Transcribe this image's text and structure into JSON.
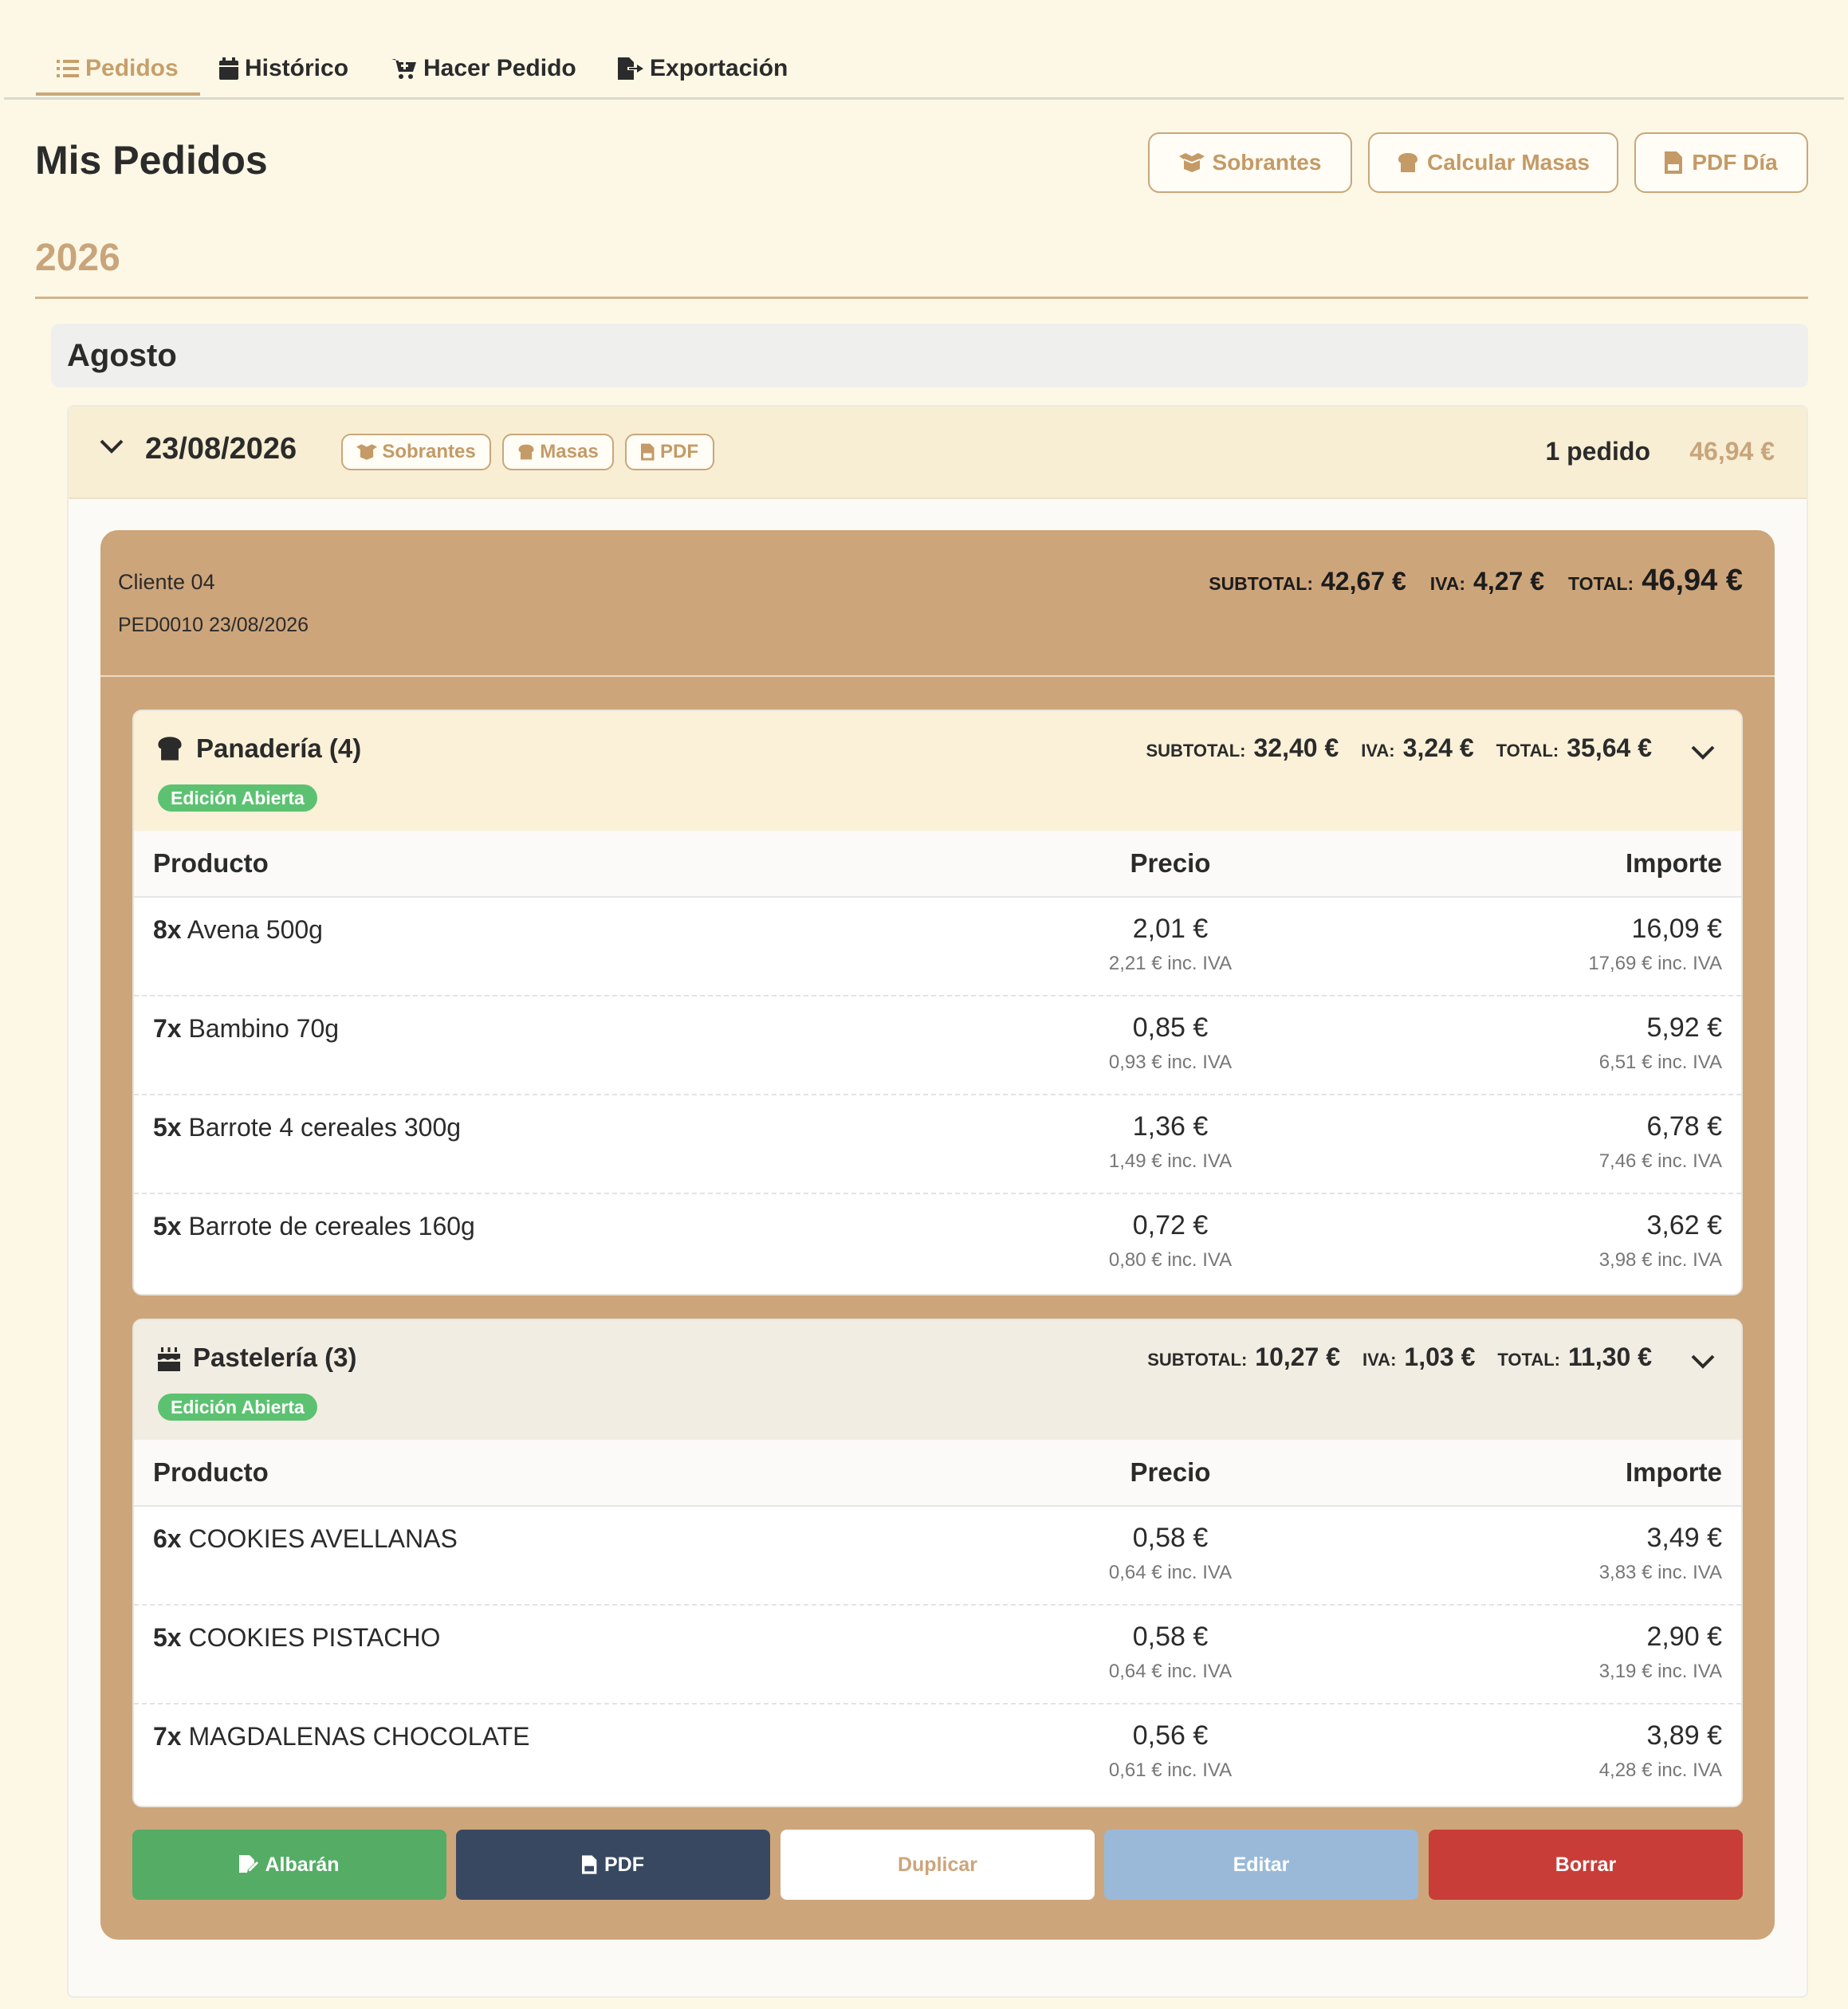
{
  "nav": {
    "tabs": [
      {
        "label": "Pedidos",
        "icon": "list-icon",
        "active": true
      },
      {
        "label": "Histórico",
        "icon": "calendar-icon",
        "active": false
      },
      {
        "label": "Hacer Pedido",
        "icon": "cart-icon",
        "active": false
      },
      {
        "label": "Exportación",
        "icon": "file-export-icon",
        "active": false
      }
    ]
  },
  "header": {
    "title": "Mis Pedidos",
    "buttons": {
      "leftovers": "Sobrantes",
      "calc_doughs": "Calcular Masas",
      "pdf_day": "PDF Día"
    }
  },
  "year": "2026",
  "month": "Agosto",
  "day": {
    "date": "23/08/2026",
    "buttons": {
      "leftovers": "Sobrantes",
      "doughs": "Masas",
      "pdf": "PDF"
    },
    "order_count": "1 pedido",
    "total": "46,94 €"
  },
  "order": {
    "client": "Cliente 04",
    "reference": "PED0010 23/08/2026",
    "labels": {
      "subtotal": "SUBTOTAL:",
      "iva": "IVA:",
      "total": "TOTAL:"
    },
    "subtotal": "42,67 €",
    "iva": "4,27 €",
    "total": "46,94 €",
    "table_headers": {
      "product": "Producto",
      "price": "Precio",
      "amount": "Importe"
    },
    "sections": [
      {
        "title": "Panadería (4)",
        "icon": "bread-icon",
        "badge": "Edición Abierta",
        "subtotal": "32,40 €",
        "iva": "3,24 €",
        "total": "35,64 €",
        "items": [
          {
            "qty": "8x",
            "name": "Avena 500g",
            "price": "2,01 €",
            "price_iva": "2,21 € inc. IVA",
            "amount": "16,09 €",
            "amount_iva": "17,69 € inc. IVA"
          },
          {
            "qty": "7x",
            "name": "Bambino 70g",
            "price": "0,85 €",
            "price_iva": "0,93 € inc. IVA",
            "amount": "5,92 €",
            "amount_iva": "6,51 € inc. IVA"
          },
          {
            "qty": "5x",
            "name": "Barrote 4 cereales 300g",
            "price": "1,36 €",
            "price_iva": "1,49 € inc. IVA",
            "amount": "6,78 €",
            "amount_iva": "7,46 € inc. IVA"
          },
          {
            "qty": "5x",
            "name": "Barrote de cereales 160g",
            "price": "0,72 €",
            "price_iva": "0,80 € inc. IVA",
            "amount": "3,62 €",
            "amount_iva": "3,98 € inc. IVA"
          }
        ]
      },
      {
        "title": "Pastelería (3)",
        "icon": "cake-icon",
        "badge": "Edición Abierta",
        "subtotal": "10,27 €",
        "iva": "1,03 €",
        "total": "11,30 €",
        "items": [
          {
            "qty": "6x",
            "name": "COOKIES AVELLANAS",
            "price": "0,58 €",
            "price_iva": "0,64 € inc. IVA",
            "amount": "3,49 €",
            "amount_iva": "3,83 € inc. IVA"
          },
          {
            "qty": "5x",
            "name": "COOKIES PISTACHO",
            "price": "0,58 €",
            "price_iva": "0,64 € inc. IVA",
            "amount": "2,90 €",
            "amount_iva": "3,19 € inc. IVA"
          },
          {
            "qty": "7x",
            "name": "MAGDALENAS CHOCOLATE",
            "price": "0,56 €",
            "price_iva": "0,61 € inc. IVA",
            "amount": "3,89 €",
            "amount_iva": "4,28 € inc. IVA"
          }
        ]
      }
    ],
    "actions": {
      "delivery_note": "Albarán",
      "pdf": "PDF",
      "duplicate": "Duplicar",
      "edit": "Editar",
      "delete": "Borrar"
    }
  },
  "colors": {
    "page_bg": "#fdf8e6",
    "accent": "#c9a77a",
    "order_card": "#cda57b",
    "badge_green": "#5cc271",
    "albaran_green": "#55ac65",
    "pdf_navy": "#384861",
    "edit_blue": "#9ab9d9",
    "delete_red": "#c83d38"
  }
}
